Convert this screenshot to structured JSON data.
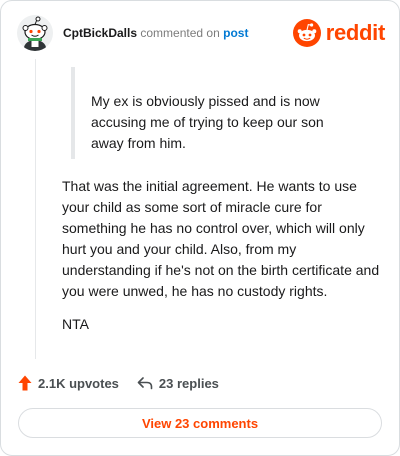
{
  "header": {
    "username": "CptBickDalls",
    "action_text": "commented on",
    "post_link": "post",
    "brand_name": "reddit",
    "icons": {
      "avatar": "snoo-avatar",
      "brand_icon": "reddit-alien-icon"
    }
  },
  "comment": {
    "quote": "My ex is obviously pissed and is now accusing me of trying to keep our son away from him.",
    "body": "That was the initial agreement. He wants to use your child as some sort of miracle cure for something he has no control over, which will only hurt you and your child. Also, from my understanding if he's not on the birth certificate and you were unwed, he has no custody rights.",
    "verdict": "NTA"
  },
  "stats": {
    "upvotes": "2.1K upvotes",
    "replies": "23 replies",
    "icons": {
      "upvote": "upvote-arrow-icon",
      "reply": "reply-arrow-icon"
    }
  },
  "footer": {
    "view_comments_label": "View 23 comments"
  },
  "colors": {
    "brand": "#ff4500",
    "link": "#0079d3",
    "text": "#1a1a1b",
    "muted": "#7c7c7c"
  }
}
